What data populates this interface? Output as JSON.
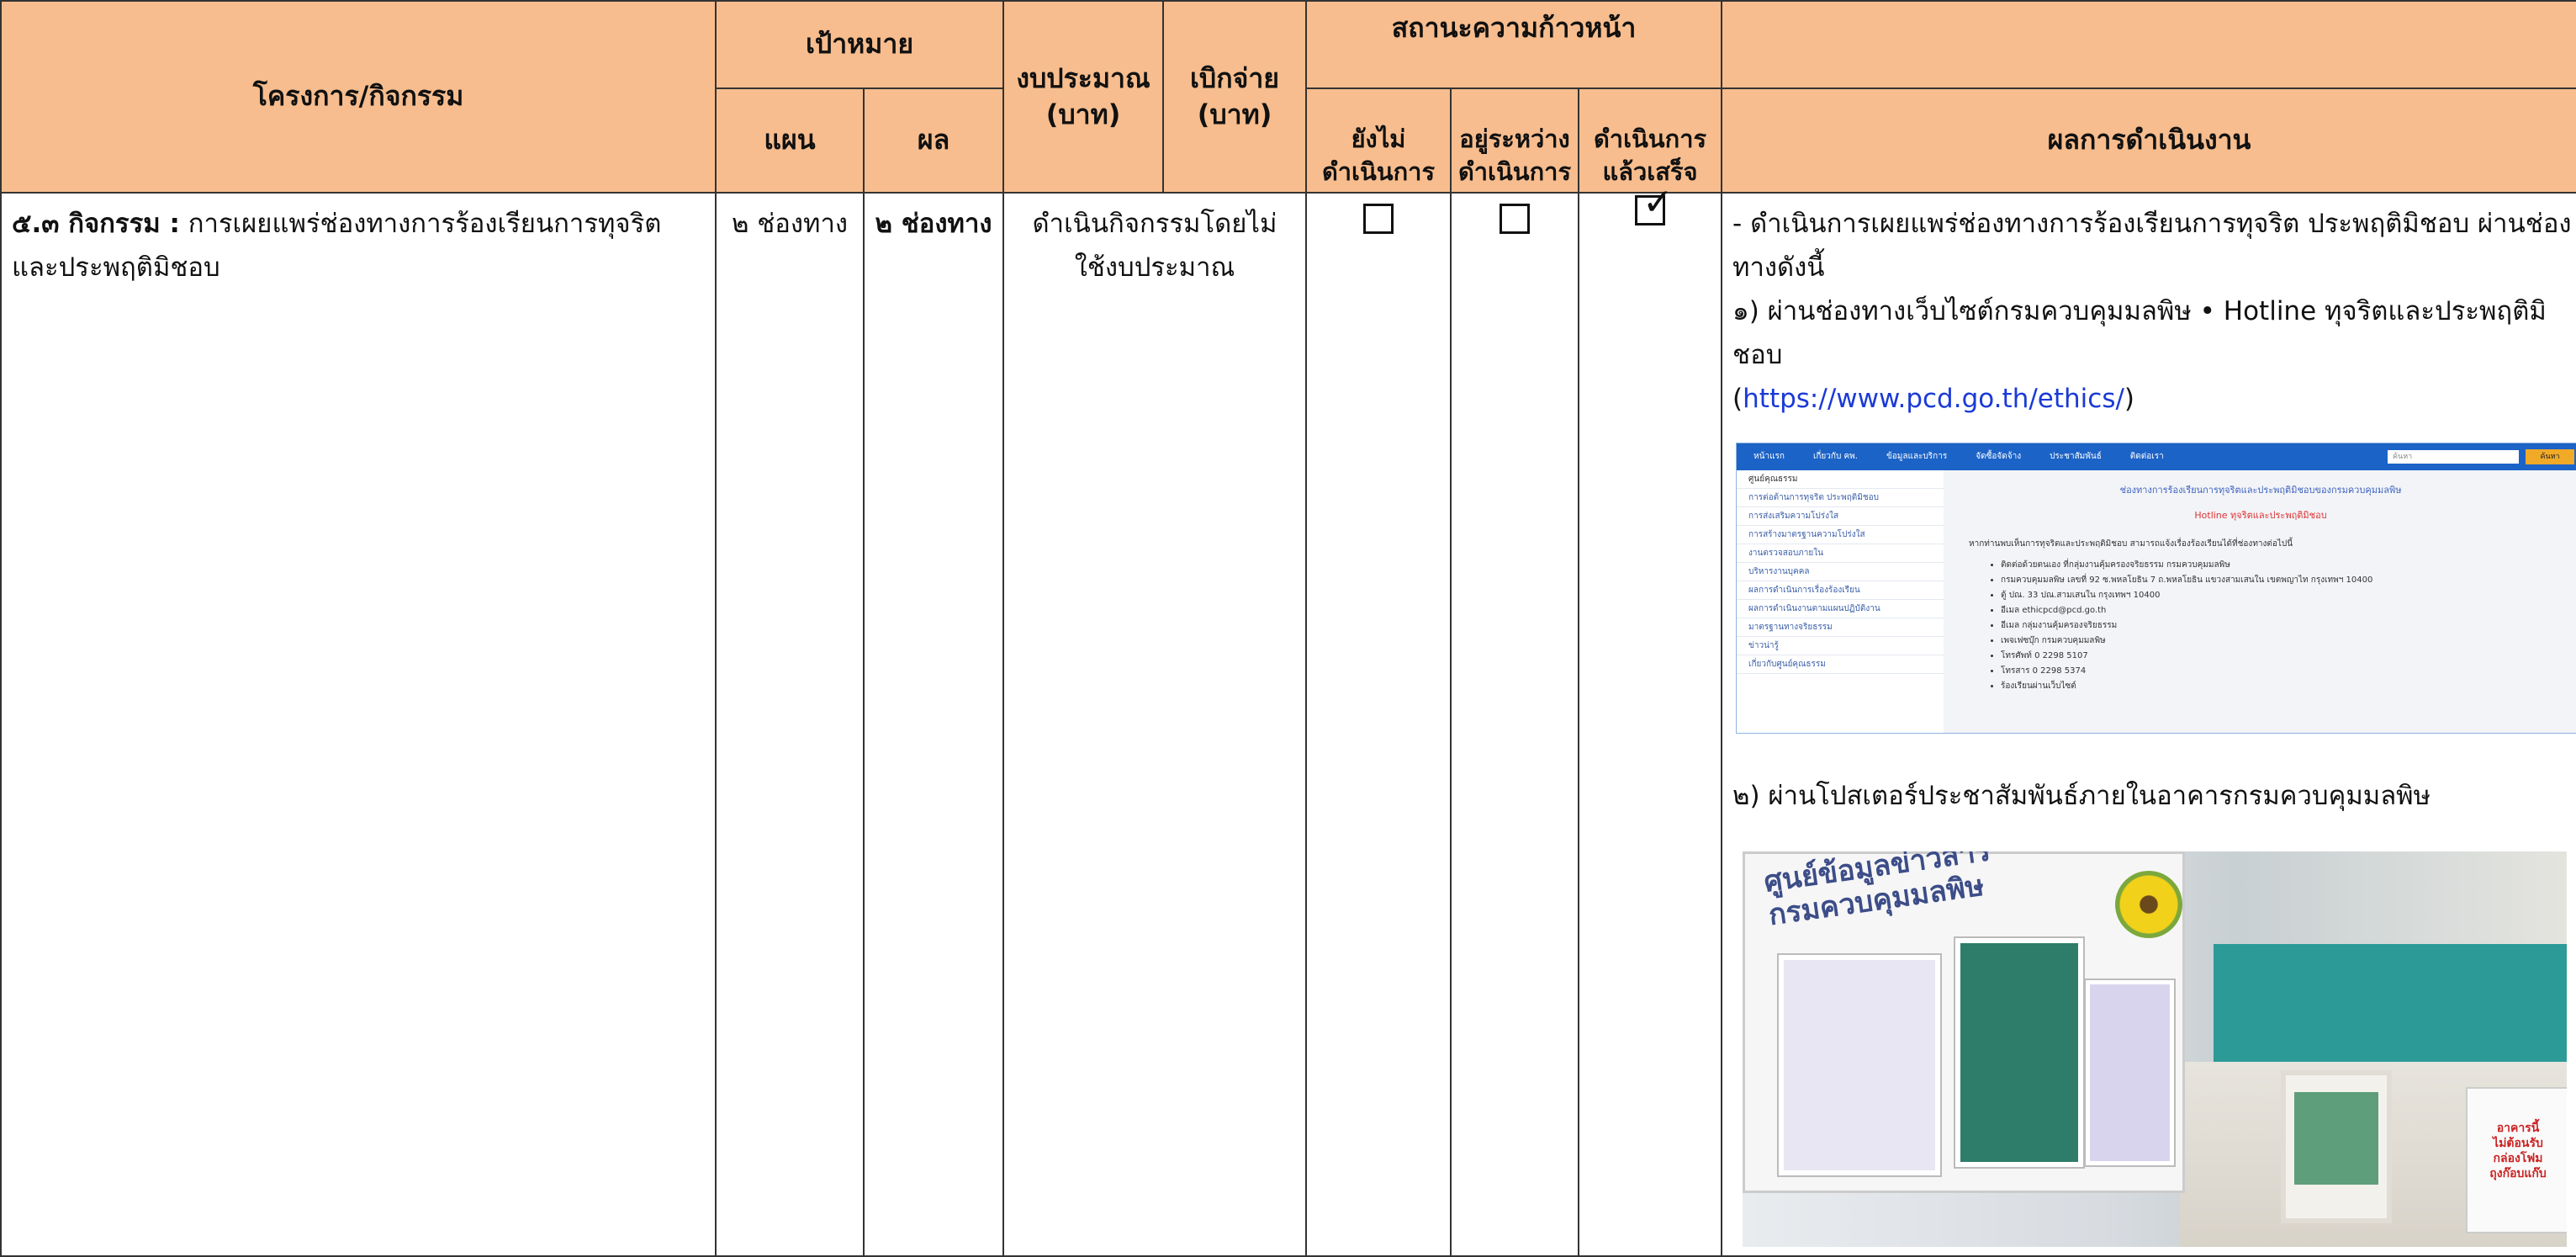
{
  "header": {
    "project": "โครงการ/กิจกรรม",
    "target": "เป้าหมาย",
    "plan": "แผน",
    "result": "ผล",
    "budget": "งบประมาณ\n(บาท)",
    "disbursed": "เบิกจ่าย\n(บาท)",
    "progress": "สถานะความก้าวหน้า",
    "not_started": "ยังไม่\nดำเนินการ",
    "in_progress": "อยู่ระหว่าง\nดำเนินการ",
    "completed": "ดำเนินการ\nแล้วเสร็จ",
    "performance": "ผลการดำเนินงาน"
  },
  "row": {
    "code": "๕.๓ กิจกรรม :",
    "activity": " การเผยแพร่ช่องทางการร้องเรียนการทุจริตและประพฤติมิชอบ",
    "plan": "๒ ช่องทาง",
    "result": "๒ ช่องทาง",
    "budget": "ดำเนินกิจกรรมโดยไม่ใช้งบประมาณ",
    "status": {
      "not_started": false,
      "in_progress": false,
      "completed": true
    },
    "performance": {
      "intro": "- ดำเนินการเผยแพร่ช่องทางการร้องเรียนการทุจริต ประพฤติมิชอบ ผ่านช่องทางดังนี้",
      "item1": "๑) ผ่านช่องทางเว็บไซต์กรมควบคุมมลพิษ • Hotline ทุจริตและประพฤติมิชอบ",
      "link_open": "(",
      "link": "https://www.pcd.go.th/ethics/",
      "link_close": ")",
      "item2": "๒) ผ่านโปสเตอร์ประชาสัมพันธ์ภายในอาคารกรมควบคุมมลพิษ"
    }
  },
  "website": {
    "nav": [
      "หน้าแรก",
      "เกี่ยวกับ คพ.",
      "ข้อมูลและบริการ",
      "จัดซื้อจัดจ้าง",
      "ประชาสัมพันธ์",
      "ติดต่อเรา"
    ],
    "search": "ค้นหา",
    "search_button": "ค้นหา",
    "side_title": "ศูนย์คุณธรรม",
    "side_items": [
      "การต่อต้านการทุจริต ประพฤติมิชอบ",
      "การส่งเสริมความโปร่งใส",
      "การสร้างมาตรฐานความโปร่งใส",
      "งานตรวจสอบภายใน",
      "บริหารงานบุคคล",
      "ผลการดำเนินการเรื่องร้องเรียน",
      "ผลการดำเนินงานตามแผนปฏิบัติงาน",
      "มาตรฐานทางจริยธรรม",
      "ข่าวน่ารู้",
      "เกี่ยวกับศูนย์คุณธรรม"
    ],
    "main_title": "ช่องทางการร้องเรียนการทุจริตและประพฤติมิชอบของกรมควบคุมมลพิษ",
    "main_subtitle": "Hotline ทุจริตและประพฤติมิชอบ",
    "main_text": "หากท่านพบเห็นการทุจริตและประพฤติมิชอบ สามารถแจ้งเรื่องร้องเรียนได้ที่ช่องทางต่อไปนี้",
    "main_list": [
      "ติดต่อด้วยตนเอง ที่กลุ่มงานคุ้มครองจริยธรรม กรมควบคุมมลพิษ",
      "กรมควบคุมมลพิษ เลขที่ 92 ซ.พหลโยธิน 7 ถ.พหลโยธิน แขวงสามเสนใน เขตพญาไท กรุงเทพฯ 10400",
      "ตู้ ปณ. 33 ปณ.สามเสนใน กรุงเทพฯ 10400",
      "อีเมล ethicpcd@pcd.go.th",
      "อีเมล กลุ่มงานคุ้มครองจริยธรรม",
      "เพจเฟซบุ๊ก กรมควบคุมมลพิษ",
      "โทรศัพท์ 0 2298 5107",
      "โทรสาร 0 2298 5374",
      "ร้องเรียนผ่านเว็บไซต์"
    ]
  },
  "poster": {
    "banner": "ศูนย์ข้อมูลข่าวสาร\nกรมควบคุมมลพิษ",
    "sign": "อาคารนี้\nไม่ต้อนรับ\nกล่องโฟม\nถุงก๊อบแก๊บ"
  }
}
